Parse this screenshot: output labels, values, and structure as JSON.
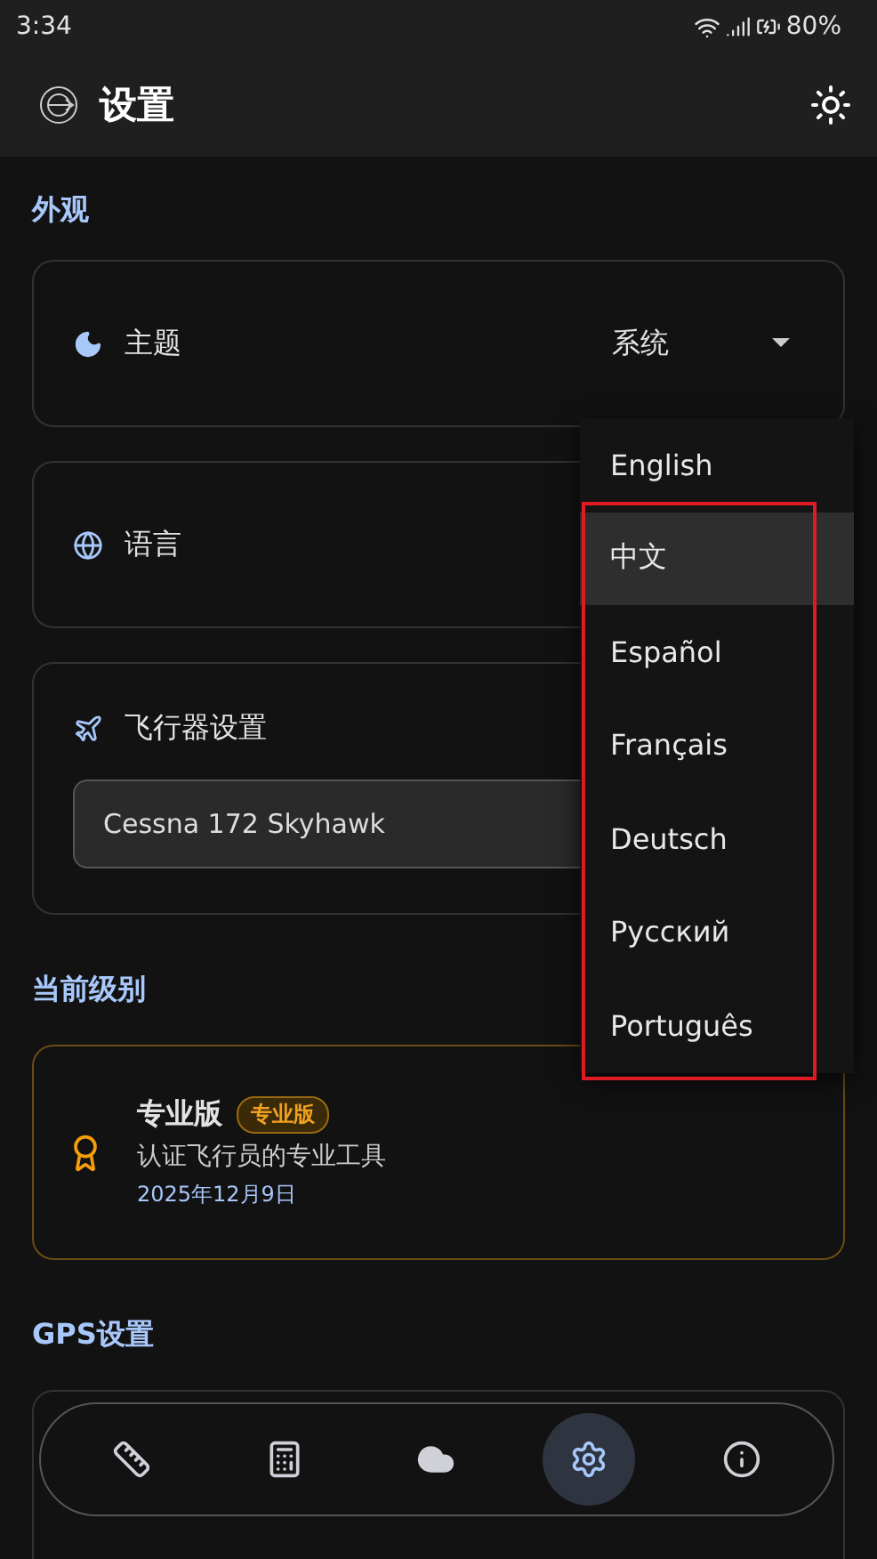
{
  "status_bar": {
    "time": "3:34",
    "battery": "80%"
  },
  "app_bar": {
    "title": "设置"
  },
  "sections": [
    {
      "title": "外观",
      "cards": [
        {
          "kind": "select",
          "label": "主题",
          "value": "系统"
        },
        {
          "kind": "plain",
          "label": "语言"
        },
        {
          "kind": "field",
          "label": "飞行器设置",
          "field_value": "Cessna 172 Skyhawk"
        }
      ]
    },
    {
      "title": "当前级别",
      "cards": [
        {
          "kind": "tier",
          "name": "专业版",
          "badge": "专业版",
          "description": "认证飞行员的专业工具",
          "date": "2025年12月9日"
        }
      ]
    },
    {
      "title": "GPS设置",
      "cards": [
        {
          "kind": "blurred"
        }
      ]
    }
  ],
  "language_menu": {
    "items": [
      {
        "label": "English",
        "selected": false
      },
      {
        "label": "中文",
        "selected": true
      },
      {
        "label": "Español",
        "selected": false
      },
      {
        "label": "Français",
        "selected": false
      },
      {
        "label": "Deutsch",
        "selected": false
      },
      {
        "label": "Русский",
        "selected": false
      },
      {
        "label": "Português",
        "selected": false
      }
    ]
  },
  "bottom_nav": [
    {
      "selected": false
    },
    {
      "selected": false
    },
    {
      "selected": false
    },
    {
      "selected": true
    },
    {
      "selected": false
    }
  ]
}
